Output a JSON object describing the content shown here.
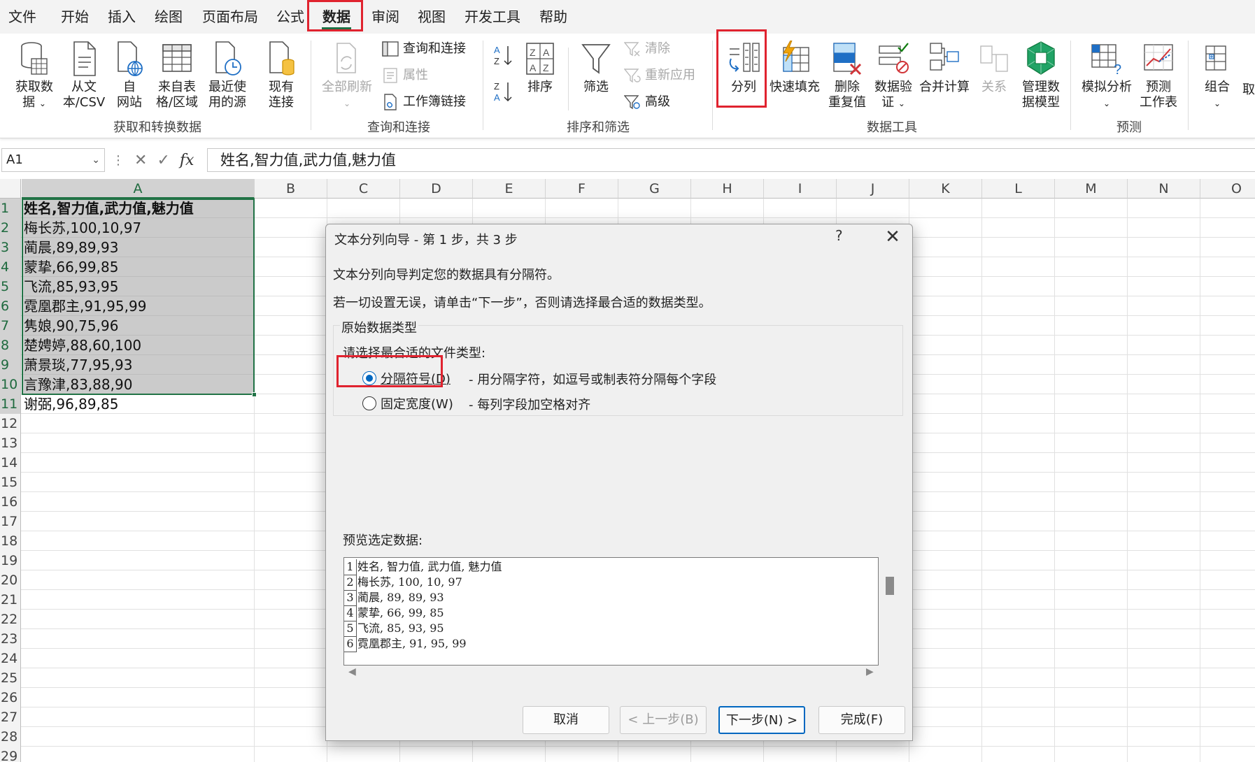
{
  "menu": {
    "items": [
      "文件",
      "开始",
      "插入",
      "绘图",
      "页面布局",
      "公式",
      "数据",
      "审阅",
      "视图",
      "开发工具",
      "帮助"
    ],
    "active": "数据"
  },
  "ribbon": {
    "get_data": {
      "group_label": "获取和转换数据",
      "get_data_btn": "获取数\n据",
      "from_text_btn": "从文\n本/CSV",
      "from_web_btn": "自\n网站",
      "from_table_btn": "来自表\n格/区域",
      "recent_btn": "最近使\n用的源",
      "existing_btn": "现有\n连接"
    },
    "queries": {
      "group_label": "查询和连接",
      "refresh_all_btn": "全部刷新",
      "queries_conn": "查询和连接",
      "properties": "属性",
      "workbook_links": "工作簿链接"
    },
    "sort_filter": {
      "group_label": "排序和筛选",
      "sort_btn": "排序",
      "filter_btn": "筛选",
      "clear": "清除",
      "reapply": "重新应用",
      "advanced": "高级"
    },
    "data_tools": {
      "group_label": "数据工具",
      "text_to_columns": "分列",
      "flash_fill": "快速填充",
      "remove_dup": "删除\n重复值",
      "validation": "数据验\n证",
      "consolidate": "合并计算",
      "relationships": "关系",
      "data_model": "管理数\n据模型"
    },
    "forecast": {
      "group_label": "预测",
      "what_if": "模拟分析",
      "forecast_sheet": "预测\n工作表"
    },
    "outline": {
      "group_btn": "组合",
      "cut_label": "取"
    }
  },
  "formula_bar": {
    "name_box": "A1",
    "fx": "fx",
    "content": "姓名,智力值,武力值,魅力值"
  },
  "grid": {
    "columns": [
      "A",
      "B",
      "C",
      "D",
      "E",
      "F",
      "G",
      "H",
      "I",
      "J",
      "K",
      "L",
      "M",
      "N",
      "O"
    ],
    "rows": [
      "1",
      "2",
      "3",
      "4",
      "5",
      "6",
      "7",
      "8",
      "9",
      "10",
      "11",
      "12",
      "13",
      "14",
      "15",
      "16",
      "17",
      "18",
      "19",
      "20",
      "21",
      "22",
      "23",
      "24",
      "25",
      "26",
      "27",
      "28",
      "29"
    ],
    "cells_a": [
      "姓名,智力值,武力值,魅力值",
      "梅长苏,100,10,97",
      "蔺晨,89,89,93",
      "蒙挚,66,99,85",
      "飞流,85,93,95",
      "霓凰郡主,91,95,99",
      "隽娘,90,75,96",
      "楚娉婷,88,60,100",
      "萧景琰,77,95,93",
      "言豫津,83,88,90",
      "谢弼,96,89,85"
    ]
  },
  "dialog": {
    "title": "文本分列向导 - 第 1 步，共 3 步",
    "help": "?",
    "close": "✕",
    "line1": "文本分列向导判定您的数据具有分隔符。",
    "line2": "若一切设置无误，请单击“下一步”，否则请选择最合适的数据类型。",
    "group_title": "原始数据类型",
    "choose_label": "请选择最合适的文件类型:",
    "opt_delimited": "分隔符号(D)",
    "opt_delimited_desc": "- 用分隔字符，如逗号或制表符分隔每个字段",
    "opt_fixed": "固定宽度(W)",
    "opt_fixed_desc": "- 每列字段加空格对齐",
    "selected_option": "delimited",
    "preview_label": "预览选定数据:",
    "preview_rows": [
      {
        "n": "1",
        "text": "姓名, 智力值, 武力值, 魅力值"
      },
      {
        "n": "2",
        "text": "梅长苏, 100, 10, 97"
      },
      {
        "n": "3",
        "text": "蔺晨, 89, 89, 93"
      },
      {
        "n": "4",
        "text": "蒙挚, 66, 99, 85"
      },
      {
        "n": "5",
        "text": "飞流, 85, 93, 95"
      },
      {
        "n": "6",
        "text": "霓凰郡主, 91, 95, 99"
      }
    ],
    "buttons": {
      "cancel": "取消",
      "back": "< 上一步(B)",
      "next": "下一步(N) >",
      "finish": "完成(F)"
    }
  },
  "colors": {
    "highlight_box": "#e0232f",
    "excel_green": "#217346",
    "radio_blue": "#0067c0"
  }
}
